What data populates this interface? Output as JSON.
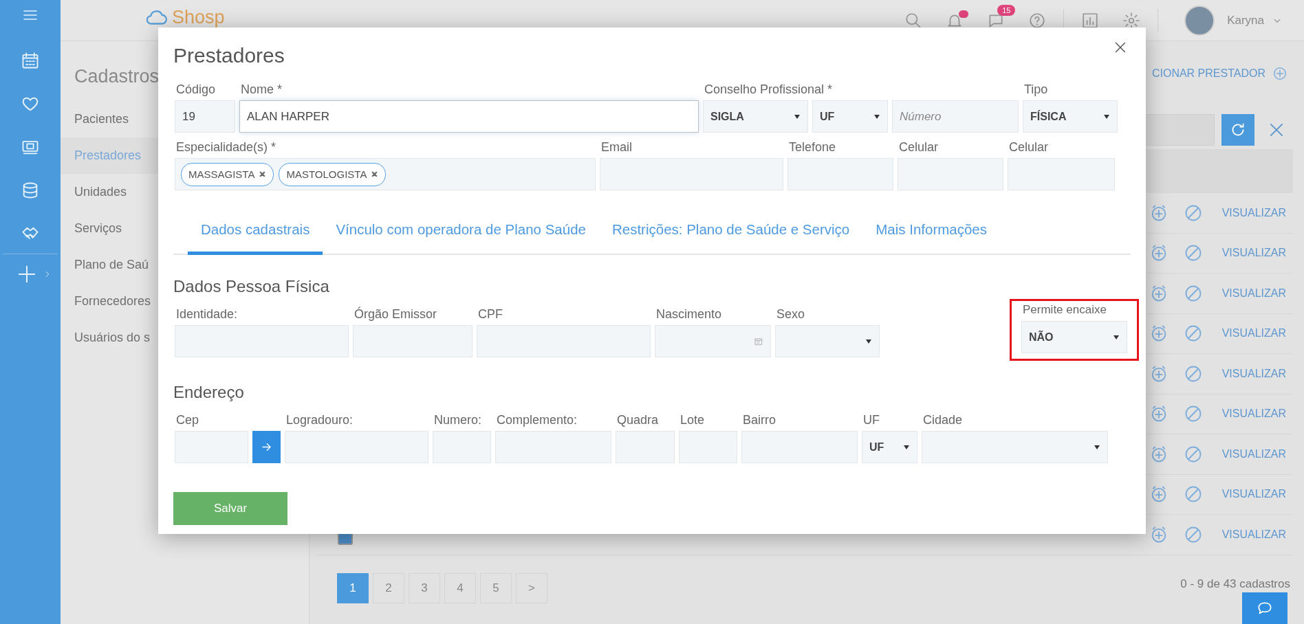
{
  "topbar": {
    "logo": "Shosp",
    "badge": "15",
    "user": "Karyna"
  },
  "subnav": {
    "title": "Cadastros",
    "items": [
      {
        "label": "Pacientes",
        "selected": false
      },
      {
        "label": "Prestadores",
        "selected": true
      },
      {
        "label": "Unidades",
        "selected": false
      },
      {
        "label": "Serviços",
        "selected": false
      },
      {
        "label": "Plano de Saú",
        "selected": false
      },
      {
        "label": "Fornecedores",
        "selected": false
      },
      {
        "label": "Usuários do s",
        "selected": false
      }
    ]
  },
  "main": {
    "add_link": "CIONAR PRESTADOR",
    "rows": [
      {
        "action": "VISUALIZAR"
      },
      {
        "action": "VISUALIZAR"
      },
      {
        "action": "VISUALIZAR"
      },
      {
        "action": "VISUALIZAR"
      },
      {
        "action": "VISUALIZAR"
      },
      {
        "action": "VISUALIZAR"
      },
      {
        "action": "VISUALIZAR"
      },
      {
        "action": "VISUALIZAR"
      },
      {
        "action": "VISUALIZAR",
        "checked": true
      }
    ],
    "pages": [
      {
        "label": "1",
        "selected": true
      },
      {
        "label": "2",
        "selected": false
      },
      {
        "label": "3",
        "selected": false
      },
      {
        "label": "4",
        "selected": false
      },
      {
        "label": "5",
        "selected": false
      },
      {
        "label": ">",
        "selected": false
      }
    ],
    "count": "0 - 9 de 43 cadastros"
  },
  "modal": {
    "title": "Prestadores",
    "top_rows": [
      {
        "fields": [
          {
            "label": "Código",
            "kind": "text",
            "value": "19",
            "focused": false
          },
          {
            "label": "Nome *",
            "kind": "text",
            "value": "ALAN HARPER",
            "focused": true
          },
          {
            "label": "Conselho Profissional *",
            "kind": "group",
            "fields": [
              {
                "kind": "select",
                "value": "SIGLA",
                "focused": false
              },
              {
                "kind": "select",
                "value": "UF",
                "focused": false
              },
              {
                "kind": "text",
                "placeholder": "Número",
                "focused": false
              }
            ]
          },
          {
            "label": "Tipo",
            "kind": "select",
            "value": "FÍSICA",
            "focused": false
          }
        ]
      },
      {
        "fields": [
          {
            "label": "Especialidade(s) *",
            "kind": "tags",
            "tags": [
              "MASSAGISTA",
              "MASTOLOGISTA"
            ],
            "focused": false
          },
          {
            "label": "Email",
            "kind": "text",
            "focused": false
          },
          {
            "label": "Telefone",
            "kind": "text",
            "focused": false
          },
          {
            "label": "Celular",
            "kind": "text",
            "focused": false
          },
          {
            "label": "Celular",
            "kind": "text",
            "focused": false
          }
        ]
      }
    ],
    "tabs": [
      {
        "label": "Dados cadastrais",
        "selected": true
      },
      {
        "label": "Vínculo com operadora de Plano Saúde",
        "selected": false
      },
      {
        "label": "Restrições: Plano de Saúde e Serviço",
        "selected": false
      },
      {
        "label": "Mais Informações",
        "selected": false
      }
    ],
    "sections": [
      {
        "title": "Dados Pessoa Física",
        "fields": [
          {
            "label": "Identidade:",
            "kind": "text",
            "focused": false
          },
          {
            "label": "Órgão Emissor",
            "kind": "text",
            "focused": false
          },
          {
            "label": "CPF",
            "kind": "text",
            "focused": false
          },
          {
            "label": "Nascimento",
            "kind": "date",
            "focused": false
          },
          {
            "label": "Sexo",
            "kind": "select",
            "focused": false
          },
          {
            "label": "Permite encaixe",
            "kind": "select",
            "value": "NÃO",
            "focused": false,
            "highlighted": true
          }
        ]
      },
      {
        "title": "Endereço",
        "fields": [
          {
            "label": "Cep",
            "kind": "text",
            "focused": false
          },
          {
            "kind": "button"
          },
          {
            "label": "Logradouro:",
            "kind": "text",
            "focused": false
          },
          {
            "label": "Numero:",
            "kind": "text",
            "focused": false
          },
          {
            "label": "Complemento:",
            "kind": "text",
            "focused": false
          },
          {
            "label": "Quadra",
            "kind": "text",
            "focused": false
          },
          {
            "label": "Lote",
            "kind": "text",
            "focused": false
          },
          {
            "label": "Bairro",
            "kind": "text",
            "focused": false
          },
          {
            "label": "UF",
            "kind": "select",
            "value": "UF",
            "focused": false
          },
          {
            "label": "Cidade",
            "kind": "select",
            "focused": false
          }
        ]
      }
    ],
    "save": "Salvar"
  }
}
